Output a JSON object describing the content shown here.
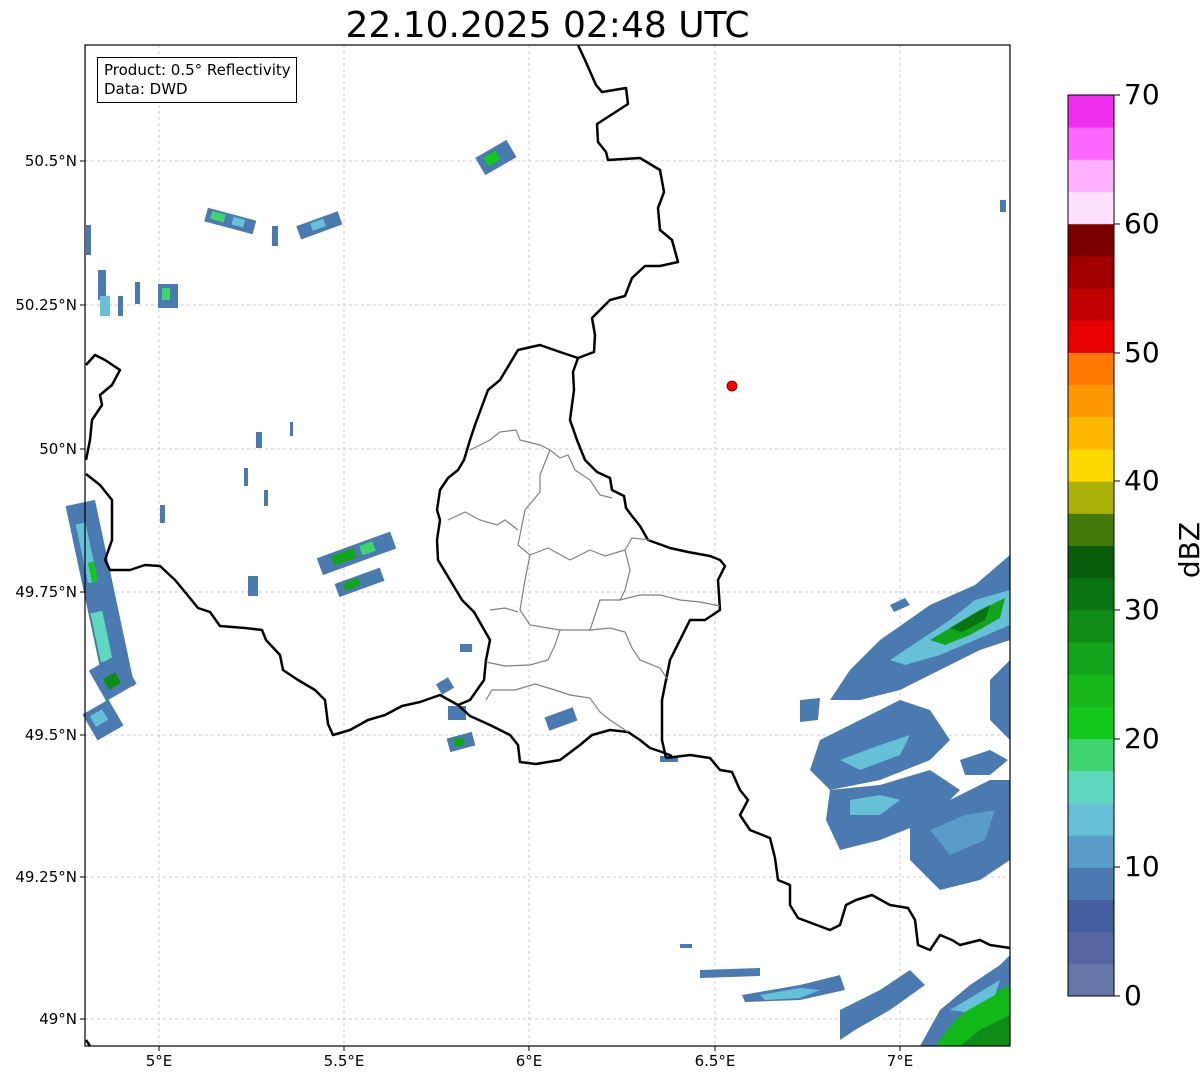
{
  "title": "22.10.2025 02:48 UTC",
  "info": {
    "product": "Product: 0.5° Reflectivity",
    "data": "Data: DWD"
  },
  "axes": {
    "lon_ticks": [
      "5°E",
      "5.5°E",
      "6°E",
      "6.5°E",
      "7°E"
    ],
    "lat_ticks": [
      "50.5°N",
      "50.25°N",
      "50°N",
      "49.75°N",
      "49.5°N",
      "49.25°N",
      "49°N"
    ]
  },
  "colorbar": {
    "label": "dBZ",
    "ticks": [
      "70",
      "60",
      "50",
      "40",
      "30",
      "20",
      "10",
      "0"
    ],
    "colors": [
      "#6677aa",
      "#5566a0",
      "#445ea0",
      "#4a7ab0",
      "#5a9cc8",
      "#66c0d8",
      "#60d8c0",
      "#3ed470",
      "#12c81a",
      "#16b81a",
      "#12a41c",
      "#0e8c16",
      "#0a7410",
      "#085c0c",
      "#447a0a",
      "#aab008",
      "#ffd800",
      "#ffb800",
      "#ff9800",
      "#ff7800",
      "#e60000",
      "#c00000",
      "#a00000",
      "#7a0000",
      "#ffe0ff",
      "#ffb0ff",
      "#ff68ff",
      "#ee30ee"
    ]
  },
  "marker": {
    "color": "#ff0000"
  },
  "grid": true
}
